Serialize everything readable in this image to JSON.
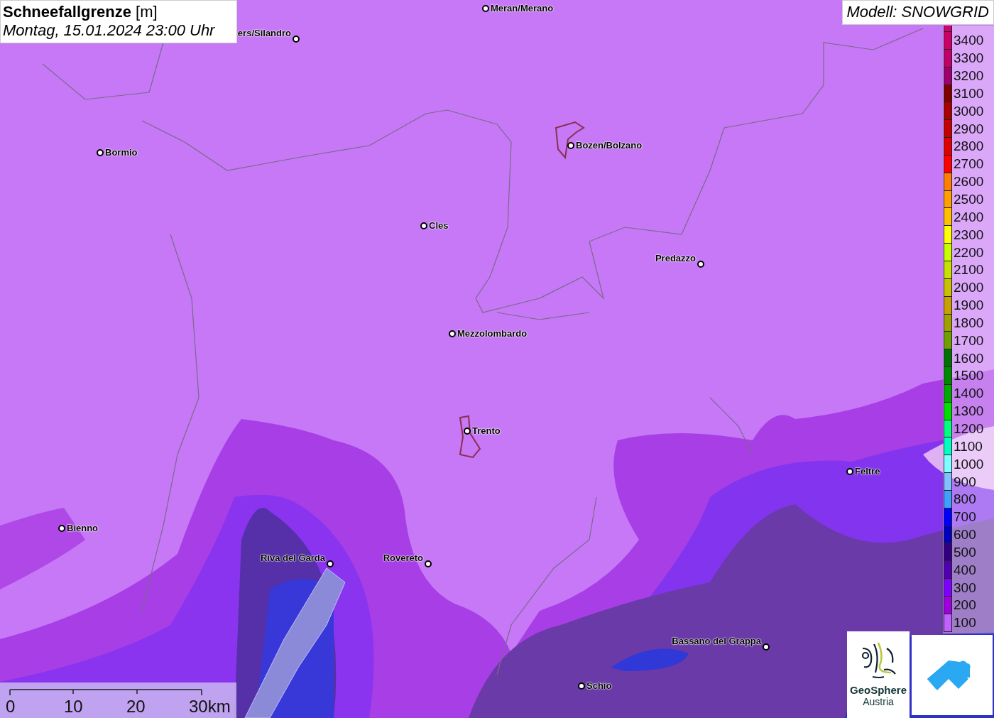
{
  "header": {
    "title": "**Schneefallgrenze** [m]",
    "subtitle": "Montag, 15.01.2024 23:00 Uhr"
  },
  "model": "Modell: SNOWGRID",
  "cities": [
    {
      "name": "Meran/Merano"
    },
    {
      "name": "ers/Silandro"
    },
    {
      "name": "Bormio"
    },
    {
      "name": "Bozen/Bolzano"
    },
    {
      "name": "Cles"
    },
    {
      "name": "Predazzo"
    },
    {
      "name": "Mezzolombardo"
    },
    {
      "name": "Trento"
    },
    {
      "name": "Feltre"
    },
    {
      "name": "Bienno"
    },
    {
      "name": "Riva del Garda"
    },
    {
      "name": "Rovereto"
    },
    {
      "name": "Bassano del Grappa"
    },
    {
      "name": "Schio"
    }
  ],
  "legend": [
    {
      "color": "#d4006e"
    },
    {
      "label": "3400",
      "color": "#cc0066"
    },
    {
      "label": "3300",
      "color": "#c2006a"
    },
    {
      "label": "3200",
      "color": "#a0006e"
    },
    {
      "label": "3100",
      "color": "#800000"
    },
    {
      "label": "3000",
      "color": "#a80000"
    },
    {
      "label": "2900",
      "color": "#c40000"
    },
    {
      "label": "2800",
      "color": "#e00000"
    },
    {
      "label": "2700",
      "color": "#ff0000"
    },
    {
      "label": "2600",
      "color": "#ff8000"
    },
    {
      "label": "2500",
      "color": "#ffa000"
    },
    {
      "label": "2400",
      "color": "#ffc000"
    },
    {
      "label": "2300",
      "color": "#ffff00"
    },
    {
      "label": "2200",
      "color": "#c8ff00"
    },
    {
      "label": "2100",
      "color": "#c8e000"
    },
    {
      "label": "2000",
      "color": "#c8c000"
    },
    {
      "label": "1900",
      "color": "#c8a000"
    },
    {
      "label": "1800",
      "color": "#a0a000"
    },
    {
      "label": "1700",
      "color": "#70a000"
    },
    {
      "label": "1600",
      "color": "#007000"
    },
    {
      "label": "1500",
      "color": "#008800"
    },
    {
      "label": "1400",
      "color": "#00a800"
    },
    {
      "label": "1300",
      "color": "#00e000"
    },
    {
      "label": "1200",
      "color": "#00ff80"
    },
    {
      "label": "1100",
      "color": "#00ffc0"
    },
    {
      "label": "1000",
      "color": "#80ffff"
    },
    {
      "label": "900",
      "color": "#80c0ff"
    },
    {
      "label": "800",
      "color": "#40a0ff"
    },
    {
      "label": "700",
      "color": "#0000ff"
    },
    {
      "label": "600",
      "color": "#0000c0"
    },
    {
      "label": "500",
      "color": "#300080"
    },
    {
      "label": "400",
      "color": "#5000b0"
    },
    {
      "label": "300",
      "color": "#8000ff"
    },
    {
      "label": "200",
      "color": "#a000e0"
    },
    {
      "label": "100",
      "color": "#c060ff"
    }
  ],
  "scale": [
    "0",
    "10",
    "20",
    "30km"
  ],
  "logo": {
    "line1": "GeoSphere",
    "line2": "Austria"
  }
}
